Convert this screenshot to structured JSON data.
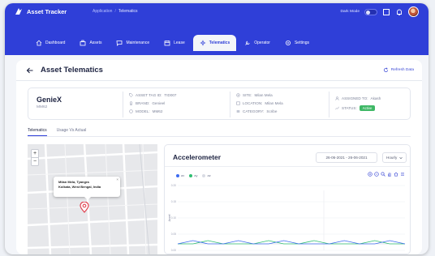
{
  "app": {
    "title": "Asset Tracker",
    "breadcrumb": [
      "Application",
      "Telematics"
    ],
    "dark_mode_label": "Dark Mode",
    "accent_color": "#2f3fd8"
  },
  "nav": {
    "items": [
      {
        "label": "Dashboard",
        "icon": "home-icon"
      },
      {
        "label": "Assets",
        "icon": "assets-icon"
      },
      {
        "label": "Maintenance",
        "icon": "maintenance-icon"
      },
      {
        "label": "Lease",
        "icon": "calendar-icon"
      },
      {
        "label": "Telematics",
        "icon": "telematics-icon",
        "active": true
      },
      {
        "label": "Operator",
        "icon": "operator-icon"
      },
      {
        "label": "Settings",
        "icon": "gear-icon"
      }
    ]
  },
  "page": {
    "title": "Asset Telematics",
    "refresh_label": "Refresh Data"
  },
  "asset": {
    "name": "GenieX",
    "model_code": "MM62",
    "tag_id_label": "ASSET TAG ID:",
    "tag_id": "TID007",
    "brand_label": "BRAND:",
    "brand": "Genieel",
    "model_label": "MODEL:",
    "model": "MM62",
    "site_label": "SITE:",
    "site": "Milan Mela",
    "location_label": "LOCATION:",
    "location": "Milan Mela",
    "category_label": "CATEGORY:",
    "category": "Scribe",
    "assigned_label": "ASSIGNED TO:",
    "assigned_to": "Akash",
    "status_label": "STATUS:",
    "status": "Active",
    "status_color": "#3fb866"
  },
  "tabs": [
    {
      "label": "Telematics",
      "active": true
    },
    {
      "label": "Usage Vs Actual",
      "active": false
    }
  ],
  "map": {
    "zoom_in": "+",
    "zoom_out": "−",
    "popup_line1": "Milan Mela, Tyangra",
    "popup_line2": "Kolkata, West Bengal, India",
    "popup_close": "×"
  },
  "chart": {
    "title": "Accelerometer",
    "date_range": "26-06-2021 - 26-06-2021",
    "interval": "Hourly",
    "y_axis_title": "Accel"
  },
  "chart_data": {
    "type": "line",
    "title": "Accelerometer",
    "ylabel": "Accel",
    "series": [
      {
        "name": "ax",
        "color": "#3d6bf0",
        "values": [
          0.02,
          0.03,
          0.02,
          0.02,
          0.03,
          0.02,
          0.02,
          0.03,
          0.02,
          0.02,
          0.02,
          0.03,
          0.02,
          0.02,
          0.03,
          0.02
        ]
      },
      {
        "name": "ay",
        "color": "#2fbf71",
        "values": [
          0.02,
          0.02,
          0.03,
          0.02,
          0.02,
          0.02,
          0.03,
          0.02,
          0.02,
          0.03,
          0.02,
          0.02,
          0.02,
          0.03,
          0.02,
          0.02
        ]
      },
      {
        "name": "az",
        "color": "#d9dce4",
        "values": [
          0.02,
          0.02,
          0.02,
          0.02,
          0.02,
          0.02,
          0.02,
          0.02,
          0.02,
          0.02,
          0.02,
          0.02,
          0.02,
          0.02,
          0.02,
          0.02
        ]
      }
    ],
    "yticks": [
      "0.20",
      "0.15",
      "0.10",
      "0.05",
      "0.00"
    ],
    "ylim": [
      0,
      0.2
    ],
    "grid": true,
    "legend_position": "top-left"
  }
}
